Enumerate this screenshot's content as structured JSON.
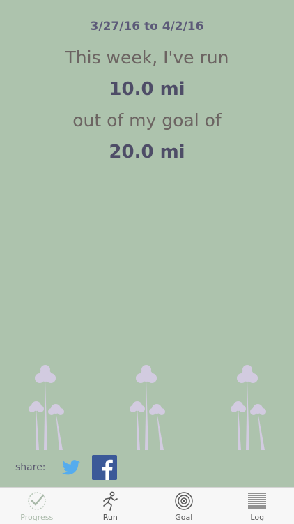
{
  "summary": {
    "date_range": "3/27/16 to 4/2/16",
    "line_this_week": "This week, I've run",
    "distance_run": "10.0 mi",
    "line_goal": "out of my goal of",
    "goal_distance": "20.0 mi"
  },
  "share": {
    "label": "share:",
    "twitter_icon": "twitter-icon",
    "facebook_icon": "facebook-icon"
  },
  "tabs": [
    {
      "label": "Progress",
      "icon": "progress-check-icon",
      "active": true
    },
    {
      "label": "Run",
      "icon": "runner-icon",
      "active": false
    },
    {
      "label": "Goal",
      "icon": "target-icon",
      "active": false
    },
    {
      "label": "Log",
      "icon": "list-lines-icon",
      "active": false
    }
  ],
  "colors": {
    "background": "#adc3ad",
    "heading": "#5c5a78",
    "text": "#6c6462",
    "emphasis": "#4e4d67",
    "palm": "#d2cbe0",
    "twitter": "#55acee",
    "facebook": "#3b5998",
    "tabbar": "#f7f7f7"
  }
}
